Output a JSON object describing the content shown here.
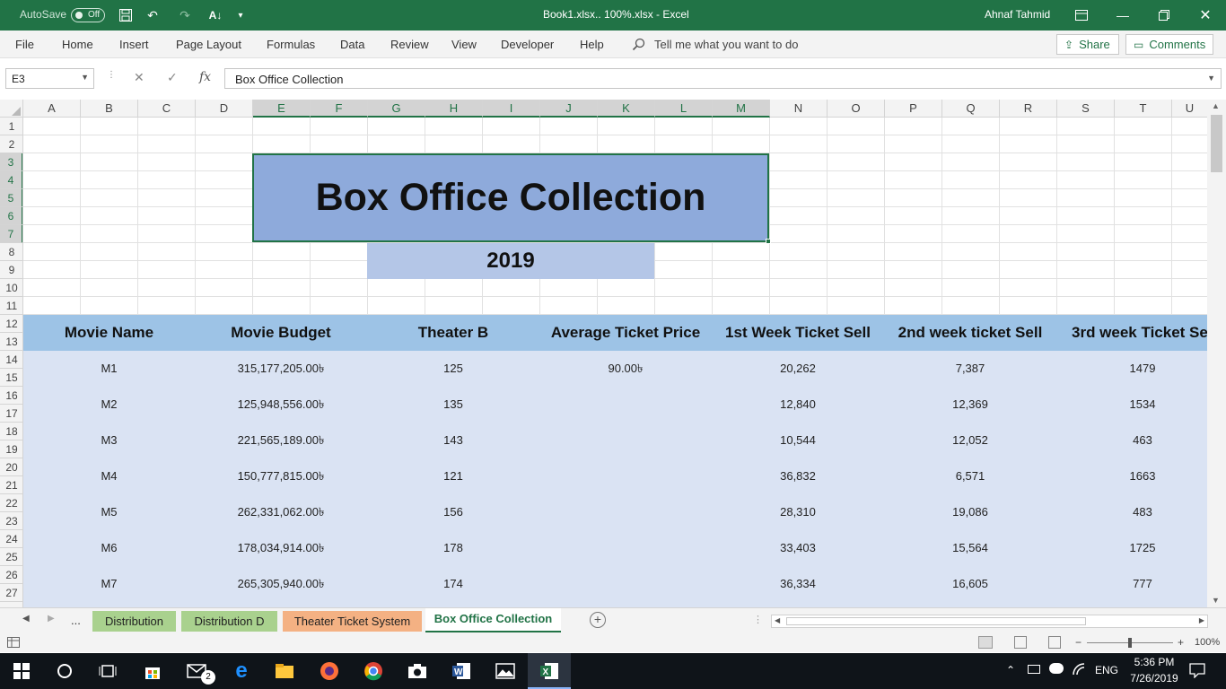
{
  "title_bar": {
    "autosave_label": "AutoSave",
    "autosave_state": "Off",
    "doc_title": "Book1.xlsx.. 100%.xlsx  -  Excel",
    "user_name": "Ahnaf Tahmid"
  },
  "ribbon": {
    "tabs": [
      "File",
      "Home",
      "Insert",
      "Page Layout",
      "Formulas",
      "Data",
      "Review",
      "View",
      "Developer",
      "Help"
    ],
    "tell_me": "Tell me what you want to do",
    "share_label": "Share",
    "comments_label": "Comments"
  },
  "formula_bar": {
    "name_box": "E3",
    "fx": "fx",
    "content": "Box Office Collection"
  },
  "grid": {
    "columns": [
      "A",
      "B",
      "C",
      "D",
      "E",
      "F",
      "G",
      "H",
      "I",
      "J",
      "K",
      "L",
      "M",
      "N",
      "O",
      "P",
      "Q",
      "R",
      "S",
      "T",
      "U"
    ],
    "rows": [
      "1",
      "2",
      "3",
      "4",
      "5",
      "6",
      "7",
      "8",
      "9",
      "10",
      "11",
      "12",
      "13",
      "14",
      "15",
      "16",
      "17",
      "18",
      "19",
      "20",
      "21",
      "22",
      "23",
      "24",
      "25",
      "26",
      "27"
    ],
    "selected_column_range": [
      "E",
      "F",
      "G",
      "H",
      "I",
      "J",
      "K",
      "L",
      "M"
    ],
    "selected_row_range": [
      "3",
      "4",
      "5",
      "6",
      "7"
    ]
  },
  "sheet": {
    "title": "Box Office Collection",
    "year": "2019",
    "headers": [
      "Movie Name",
      "Movie Budget",
      "Theater B",
      "Average Ticket Price",
      "1st Week Ticket Sell",
      "2nd week ticket Sell",
      "3rd week Ticket Se"
    ],
    "rows": [
      {
        "name": "M1",
        "budget": "315,177,205.00৳",
        "theater": "125",
        "avg_price": "90.00৳",
        "w1": "20,262",
        "w2": "7,387",
        "w3": "1479"
      },
      {
        "name": "M2",
        "budget": "125,948,556.00৳",
        "theater": "135",
        "avg_price": "",
        "w1": "12,840",
        "w2": "12,369",
        "w3": "1534"
      },
      {
        "name": "M3",
        "budget": "221,565,189.00৳",
        "theater": "143",
        "avg_price": "",
        "w1": "10,544",
        "w2": "12,052",
        "w3": "463"
      },
      {
        "name": "M4",
        "budget": "150,777,815.00৳",
        "theater": "121",
        "avg_price": "",
        "w1": "36,832",
        "w2": "6,571",
        "w3": "1663"
      },
      {
        "name": "M5",
        "budget": "262,331,062.00৳",
        "theater": "156",
        "avg_price": "",
        "w1": "28,310",
        "w2": "19,086",
        "w3": "483"
      },
      {
        "name": "M6",
        "budget": "178,034,914.00৳",
        "theater": "178",
        "avg_price": "",
        "w1": "33,403",
        "w2": "15,564",
        "w3": "1725"
      },
      {
        "name": "M7",
        "budget": "265,305,940.00৳",
        "theater": "174",
        "avg_price": "",
        "w1": "36,334",
        "w2": "16,605",
        "w3": "777"
      }
    ]
  },
  "sheet_tabs": {
    "more": "...",
    "tabs": [
      {
        "label": "Distribution",
        "color": "#a9d18e"
      },
      {
        "label": "Distribution D",
        "color": "#a9d18e"
      },
      {
        "label": "Theater Ticket System",
        "color": "#f4b183"
      },
      {
        "label": "Box Office Collection",
        "color": "#ffffff"
      }
    ]
  },
  "status_bar": {
    "zoom": "100%"
  },
  "taskbar": {
    "language": "ENG",
    "time": "5:36 PM",
    "date": "7/26/2019",
    "mail_badge": "2"
  },
  "colors": {
    "excel_green": "#217346",
    "title_fill": "#8eaadb",
    "year_fill": "#b4c6e7",
    "header_fill": "#9dc3e6",
    "body_fill": "#dae3f3"
  }
}
